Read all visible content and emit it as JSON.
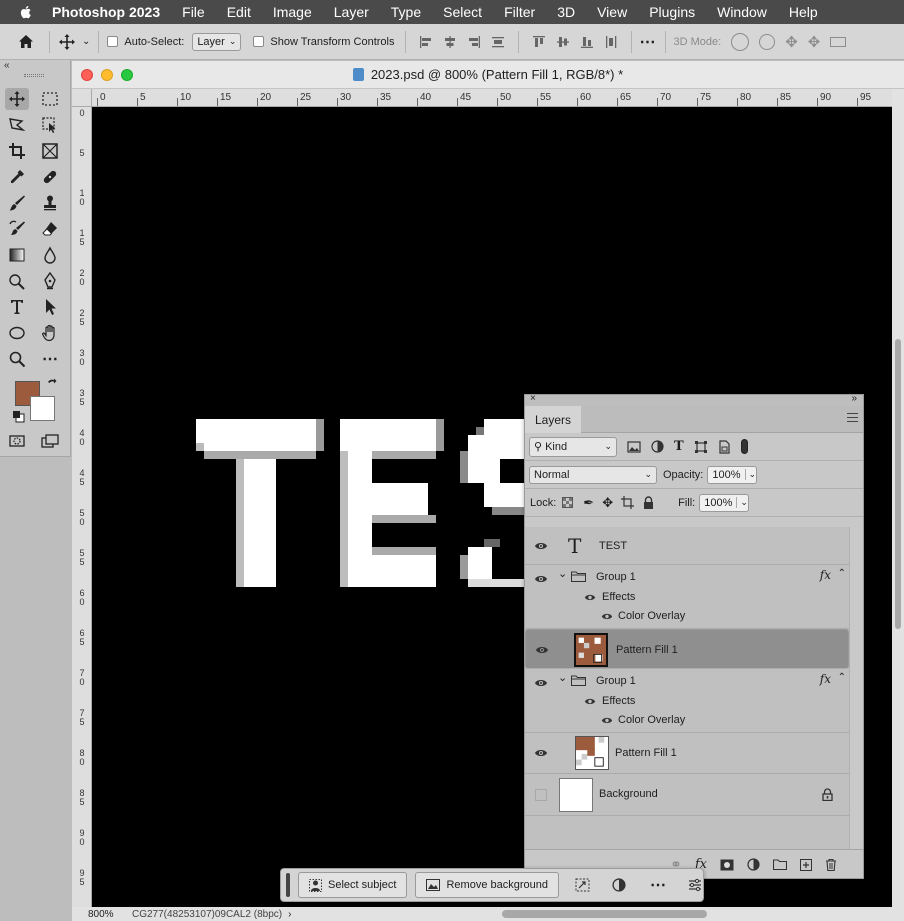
{
  "menubar": {
    "app_name": "Photoshop 2023",
    "items": [
      "File",
      "Edit",
      "Image",
      "Layer",
      "Type",
      "Select",
      "Filter",
      "3D",
      "View",
      "Plugins",
      "Window",
      "Help"
    ]
  },
  "options_bar": {
    "auto_select_label": "Auto-Select:",
    "auto_select_target": "Layer",
    "show_transform_label": "Show Transform Controls",
    "mode_3d_label": "3D Mode:"
  },
  "document": {
    "title": "2023.psd @ 800% (Pattern Fill 1, RGB/8*) *",
    "zoom": "800%",
    "status_info": "CG277(48253107)09CAL2 (8bpc)",
    "ruler_h_ticks": [
      "0",
      "5",
      "10",
      "15",
      "20",
      "25",
      "30",
      "35",
      "40",
      "45",
      "50",
      "55",
      "60",
      "65",
      "70",
      "75",
      "80",
      "85",
      "90",
      "95"
    ],
    "ruler_v_ticks": [
      "0",
      "5",
      "10",
      "15",
      "20",
      "25",
      "30",
      "35",
      "40",
      "45",
      "50",
      "55",
      "60",
      "65",
      "70",
      "75",
      "80",
      "85",
      "90",
      "95"
    ],
    "canvas_text": "TES"
  },
  "colors": {
    "foreground": "#9b5b3c",
    "background": "#ffffff",
    "canvas": "#000000"
  },
  "layers_panel": {
    "tab_label": "Layers",
    "filter_kind": "Kind",
    "blend_mode": "Normal",
    "opacity_label": "Opacity:",
    "opacity_value": "100%",
    "lock_label": "Lock:",
    "fill_label": "Fill:",
    "fill_value": "100%",
    "layers": {
      "text_layer": "TEST",
      "group1_a": "Group 1",
      "effects_a": "Effects",
      "color_overlay_a": "Color Overlay",
      "pattern_fill_a": "Pattern Fill 1",
      "group1_b": "Group 1",
      "effects_b": "Effects",
      "color_overlay_b": "Color Overlay",
      "pattern_fill_b": "Pattern Fill 1",
      "background": "Background"
    }
  },
  "taskbar": {
    "select_subject": "Select subject",
    "remove_background": "Remove background"
  }
}
